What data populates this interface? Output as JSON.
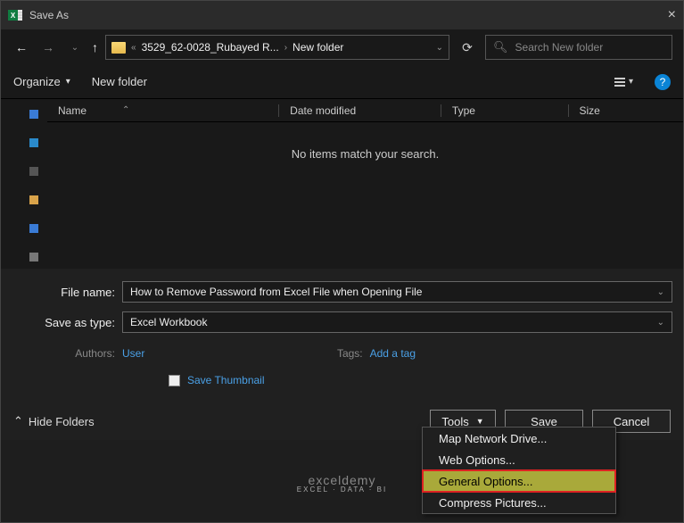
{
  "title": "Save As",
  "nav": {
    "breadcrumb_prefix": "«",
    "breadcrumb_part1": "3529_62-0028_Rubayed R...",
    "breadcrumb_part2": "New folder",
    "search_placeholder": "Search New folder"
  },
  "toolbar": {
    "organize": "Organize",
    "newfolder": "New folder"
  },
  "columns": {
    "name": "Name",
    "date": "Date modified",
    "type": "Type",
    "size": "Size"
  },
  "empty": "No items match your search.",
  "form": {
    "filename_label": "File name:",
    "filename_value": "How to Remove Password from Excel File when Opening File",
    "savetype_label": "Save as type:",
    "savetype_value": "Excel Workbook",
    "authors_label": "Authors:",
    "authors_value": "User",
    "tags_label": "Tags:",
    "tags_value": "Add a tag",
    "thumbnail_label": "Save Thumbnail"
  },
  "footer": {
    "hide": "Hide Folders",
    "tools": "Tools",
    "save": "Save",
    "cancel": "Cancel"
  },
  "menu": {
    "item1": "Map Network Drive...",
    "item2": "Web Options...",
    "item3": "General Options...",
    "item4": "Compress Pictures..."
  },
  "watermark": {
    "main": "exceldemy",
    "sub": "EXCEL · DATA · BI"
  }
}
